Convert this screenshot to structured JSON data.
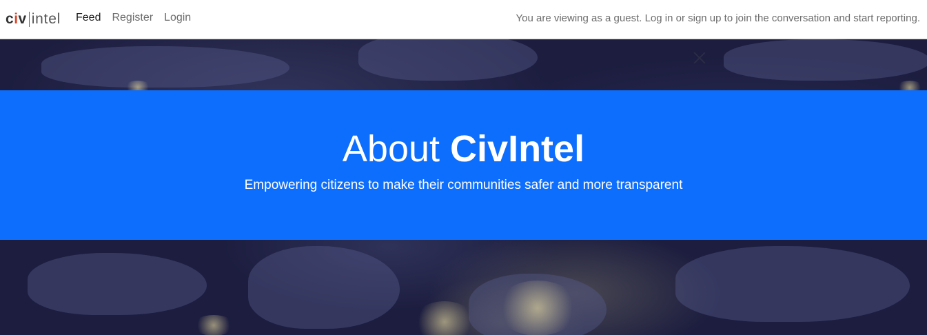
{
  "navbar": {
    "brand": {
      "part1_a": "c",
      "part1_b": "i",
      "part1_c": "v",
      "part2": "intel"
    },
    "links": [
      {
        "label": "Feed",
        "active": true
      },
      {
        "label": "Register",
        "active": false
      },
      {
        "label": "Login",
        "active": false
      }
    ],
    "guest_message": "You are viewing as a guest. Log in or sign up to join the conversation and start reporting."
  },
  "hero": {
    "close_icon": "close-icon",
    "banner": {
      "title_light": "About ",
      "title_bold": "CivIntel",
      "subtitle": "Empowering citizens to make their communities safer and more transparent"
    }
  },
  "colors": {
    "banner_bg": "#0d6efd",
    "hero_bg": "#1c1d3f",
    "brand_accent": "#d9472b"
  }
}
